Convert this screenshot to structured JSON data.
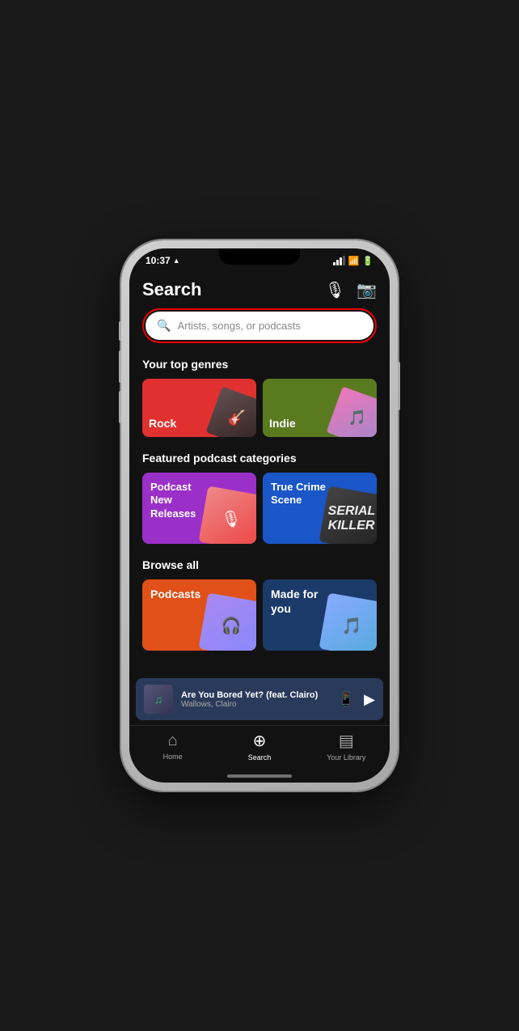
{
  "status": {
    "time": "10:37",
    "direction_icon": "▲"
  },
  "header": {
    "title": "Search",
    "mic_label": "microphone",
    "camera_label": "camera"
  },
  "search_bar": {
    "placeholder": "Artists, songs, or podcasts"
  },
  "top_genres": {
    "label": "Your top genres",
    "items": [
      {
        "name": "Rock",
        "color": "#e03030"
      },
      {
        "name": "Indie",
        "color": "#5a7a20"
      }
    ]
  },
  "podcast_categories": {
    "label": "Featured podcast categories",
    "items": [
      {
        "name": "Podcast New Releases",
        "color": "#9b30c8"
      },
      {
        "name": "True Crime Scene",
        "color": "#1a56c8"
      }
    ]
  },
  "browse_all": {
    "label": "Browse all",
    "items": [
      {
        "name": "Podcasts",
        "color": "#e05018"
      },
      {
        "name": "Made for you",
        "color": "#1a3a6a"
      }
    ]
  },
  "now_playing": {
    "title": "Are You Bored Yet? (feat. Clairo)",
    "artist": "Wallows, Clairo"
  },
  "bottom_nav": {
    "items": [
      {
        "id": "home",
        "label": "Home",
        "icon": "⌂",
        "active": false
      },
      {
        "id": "search",
        "label": "Search",
        "icon": "⊕",
        "active": true
      },
      {
        "id": "library",
        "label": "Your Library",
        "icon": "▤",
        "active": false
      }
    ]
  }
}
